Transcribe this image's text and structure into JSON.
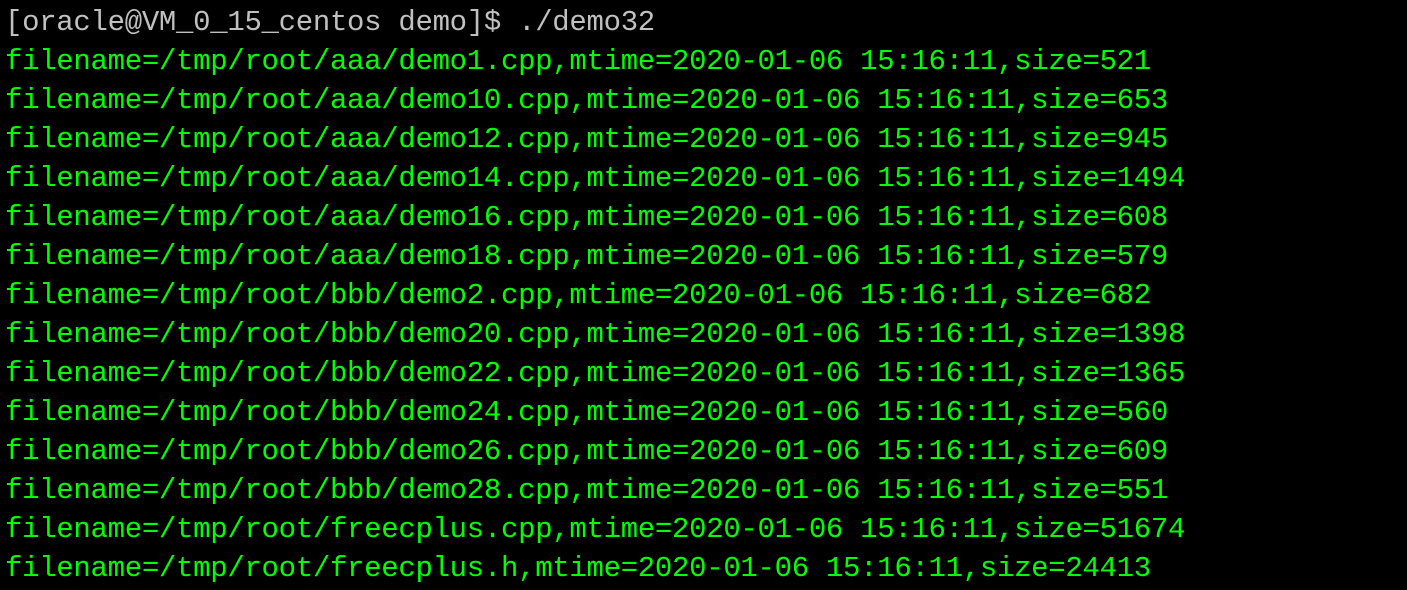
{
  "terminal": {
    "prompt": "[oracle@VM_0_15_centos demo]$",
    "command": " ./demo32",
    "output": [
      "filename=/tmp/root/aaa/demo1.cpp,mtime=2020-01-06 15:16:11,size=521",
      "filename=/tmp/root/aaa/demo10.cpp,mtime=2020-01-06 15:16:11,size=653",
      "filename=/tmp/root/aaa/demo12.cpp,mtime=2020-01-06 15:16:11,size=945",
      "filename=/tmp/root/aaa/demo14.cpp,mtime=2020-01-06 15:16:11,size=1494",
      "filename=/tmp/root/aaa/demo16.cpp,mtime=2020-01-06 15:16:11,size=608",
      "filename=/tmp/root/aaa/demo18.cpp,mtime=2020-01-06 15:16:11,size=579",
      "filename=/tmp/root/bbb/demo2.cpp,mtime=2020-01-06 15:16:11,size=682",
      "filename=/tmp/root/bbb/demo20.cpp,mtime=2020-01-06 15:16:11,size=1398",
      "filename=/tmp/root/bbb/demo22.cpp,mtime=2020-01-06 15:16:11,size=1365",
      "filename=/tmp/root/bbb/demo24.cpp,mtime=2020-01-06 15:16:11,size=560",
      "filename=/tmp/root/bbb/demo26.cpp,mtime=2020-01-06 15:16:11,size=609",
      "filename=/tmp/root/bbb/demo28.cpp,mtime=2020-01-06 15:16:11,size=551",
      "filename=/tmp/root/freecplus.cpp,mtime=2020-01-06 15:16:11,size=51674",
      "filename=/tmp/root/freecplus.h,mtime=2020-01-06 15:16:11,size=24413"
    ]
  },
  "colors": {
    "background": "#000000",
    "output_text": "#00ff00",
    "prompt_text": "#c0c0c0"
  }
}
